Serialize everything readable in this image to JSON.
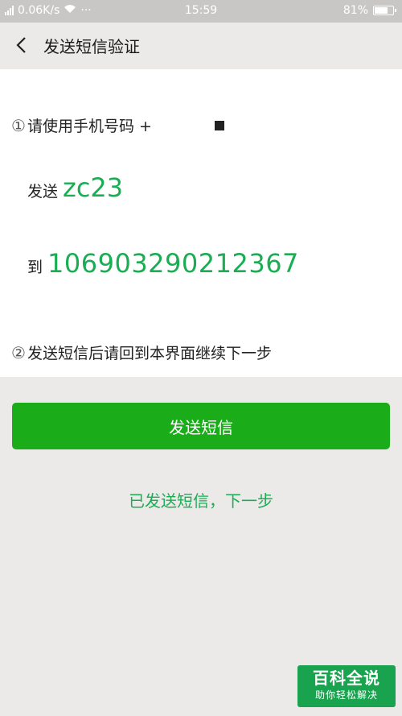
{
  "status_bar": {
    "speed": "0.06K/s",
    "dots": "···",
    "time": "15:59",
    "battery": "81%",
    "battery_level": 0.81
  },
  "header": {
    "title": "发送短信验证"
  },
  "instructions": {
    "step1_marker": "①",
    "step1_text": "请使用手机号码 +",
    "send_label": "发送",
    "code": "zc23",
    "to_label": "到",
    "phone_number": "106903290212367",
    "step2_marker": "②",
    "step2_text": "发送短信后请回到本界面继续下一步"
  },
  "buttons": {
    "send_sms": "发送短信",
    "sent_next": "已发送短信，下一步"
  },
  "watermark": {
    "title": "百科全说",
    "subtitle": "助你轻松解决"
  },
  "colors": {
    "accent": "#1aad19",
    "text_green": "#1aad53"
  }
}
